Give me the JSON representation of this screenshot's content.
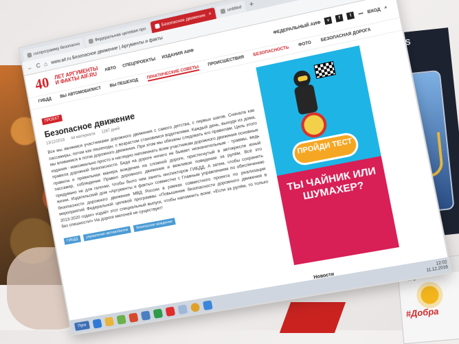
{
  "browser": {
    "tabs": [
      {
        "label": "госпрограмму безопасно",
        "active": false
      },
      {
        "label": "Федеральная целевая про",
        "active": false
      },
      {
        "label": "Безопасное движение",
        "active": true
      },
      {
        "label": "untitled",
        "active": false
      }
    ],
    "new_tab": "+",
    "window_controls": [
      "≡",
      "–",
      "□",
      "×"
    ],
    "address": "www.aif.ru  Безопасное движение | Аргументы и факты",
    "nav": {
      "back": "←",
      "refresh": "C",
      "home": "⌂"
    }
  },
  "site": {
    "logo_number": "40",
    "logo_line1": "ЛЕТ АРГУМЕНТЫ",
    "logo_line2": "И ФАКТЫ AIF.RU",
    "header_links": [
      "АВТО",
      "СПЕЦПРОЕКТЫ",
      "ИЗДАНИЯ АИФ"
    ],
    "region": "ФЕДЕРАЛЬНЫЙ АИФ",
    "login": "ВХОД",
    "more": "•••",
    "subnav": [
      {
        "label": "ГИБДД",
        "state": "normal"
      },
      {
        "label": "ВЫ АВТОМОБИЛИСТ",
        "state": "normal"
      },
      {
        "label": "ВЫ ПЕШЕХОД",
        "state": "normal"
      },
      {
        "label": "ПРАКТИЧЕСКИЕ СОВЕТЫ",
        "state": "active"
      },
      {
        "label": "ПРОИСШЕСТВИЯ",
        "state": "normal"
      },
      {
        "label": "БЕЗОПАСНОСТЬ",
        "state": "red"
      },
      {
        "label": "ФОТО",
        "state": "normal"
      },
      {
        "label": "БЕЗОПАСНАЯ ДОРОГА",
        "state": "normal"
      }
    ]
  },
  "article": {
    "badge": "ПРОЕКТ",
    "title": "Безопасное движение",
    "date": "13/12/2016",
    "materials": "44 материала",
    "days": "1287 дней",
    "body": "Все мы являемся участниками дорожного движения с самого детства, с первых шагов. Сначала как пассажиры, потом как пешеходы, с возрастом становимся водителями. Каждый день, выходя из дома, мы вливаемся в поток дорожного движения. При этом мы обязаны следовать его правилам. Цель этого издания - максимально просто и наглядно напоминать всем участникам дорожного движения основные правила дорожной безопасности. Беда на дороге ничего не бывает незначительным - травмы, ведь правила и правильная манера вождения на сложной дороге, пристегнутый в автокресле юный пассажир, соблюдение Правил дорожного движения и вежливое поведение за рулём. Всё это придумано не для галочки. Чтобы было чем занять инспекторов ГИБДД. А затем, чтобы сохранить жизни. Издательский дом «Аргументы и факты» совместно с Главным управлением по обеспечению безопасности дорожного движения МВД России в рамках совместного проекта по реализации мероприятий Федеральной целевой программы «Повышение безопасности дорожного движения в 2013-2020 годах» издаёт этот специальный выпуск, чтобы напомнить всем: «Если за рулём, то только без спешности!» На дороге мелочей не существует!",
    "tags": [
      "ГИБДД",
      "управление автомобилем",
      "безопасное вождение"
    ]
  },
  "ad": {
    "button": "ПРОЙДИ ТЕСТ",
    "headline": "ТЫ ЧАЙНИК ИЛИ ШУМАХЕР?"
  },
  "sidebar": {
    "header": "Новости"
  },
  "taskbar": {
    "start": "Пуск",
    "time": "12:02",
    "date": "11.12.2016"
  },
  "background": {
    "phone_brand": "SAMS",
    "second_window_tab": "госпрограмму безопасно",
    "second_window_nav": "← Я C",
    "dobra": "#Добра"
  },
  "colors": {
    "brand_red": "#d2232a",
    "ad_blue": "#1fb4e6",
    "ad_pink": "#d81f56",
    "ad_orange": "#f5a623"
  }
}
